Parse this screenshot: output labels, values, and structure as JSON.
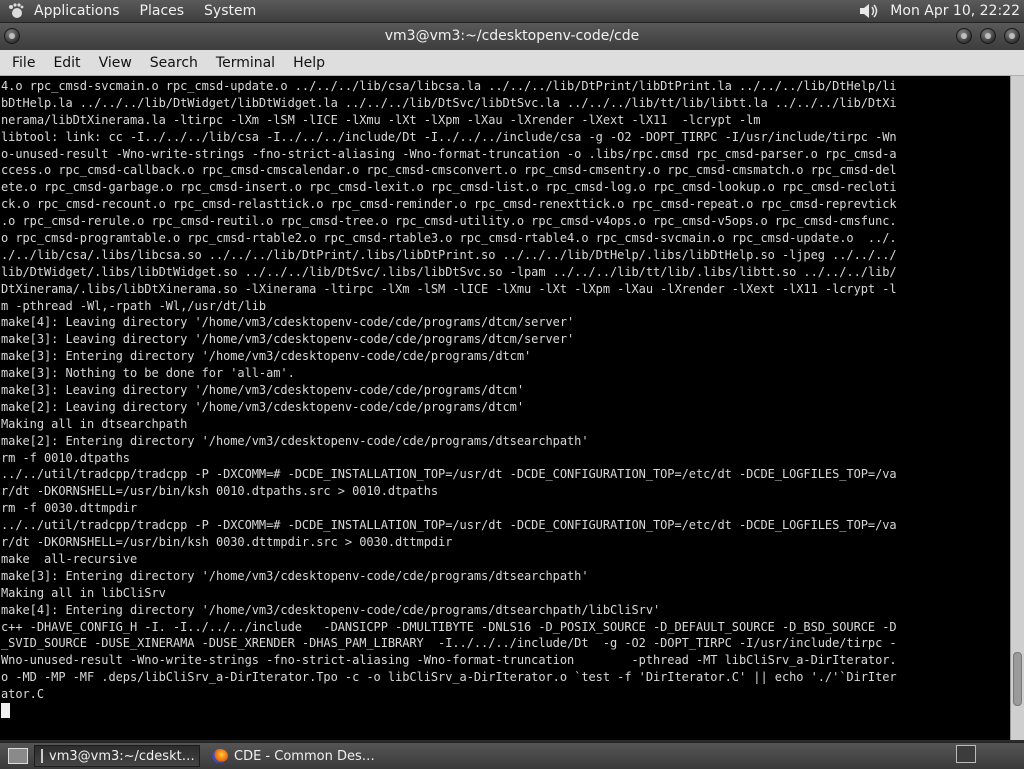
{
  "top_panel": {
    "menus": [
      "Applications",
      "Places",
      "System"
    ],
    "clock": "Mon Apr 10, 22:22",
    "icons": [
      "gnome-foot-icon",
      "volume-icon"
    ]
  },
  "window": {
    "title": "vm3@vm3:~/cdesktopenv-code/cde"
  },
  "menu_bar": {
    "items": [
      "File",
      "Edit",
      "View",
      "Search",
      "Terminal",
      "Help"
    ]
  },
  "terminal": {
    "lines": [
      "4.o rpc_cmsd-svcmain.o rpc_cmsd-update.o ../../../lib/csa/libcsa.la ../../../lib/DtPrint/libDtPrint.la ../../../lib/DtHelp/li",
      "bDtHelp.la ../../../lib/DtWidget/libDtWidget.la ../../../lib/DtSvc/libDtSvc.la ../../../lib/tt/lib/libtt.la ../../../lib/DtXi",
      "nerama/libDtXinerama.la -ltirpc -lXm -lSM -lICE -lXmu -lXt -lXpm -lXau -lXrender -lXext -lX11  -lcrypt -lm",
      "libtool: link: cc -I../../../lib/csa -I../../../include/Dt -I../../../include/csa -g -O2 -DOPT_TIRPC -I/usr/include/tirpc -Wn",
      "o-unused-result -Wno-write-strings -fno-strict-aliasing -Wno-format-truncation -o .libs/rpc.cmsd rpc_cmsd-parser.o rpc_cmsd-a",
      "ccess.o rpc_cmsd-callback.o rpc_cmsd-cmscalendar.o rpc_cmsd-cmsconvert.o rpc_cmsd-cmsentry.o rpc_cmsd-cmsmatch.o rpc_cmsd-del",
      "ete.o rpc_cmsd-garbage.o rpc_cmsd-insert.o rpc_cmsd-lexit.o rpc_cmsd-list.o rpc_cmsd-log.o rpc_cmsd-lookup.o rpc_cmsd-reclоti",
      "ck.o rpc_cmsd-recount.o rpc_cmsd-relasttick.o rpc_cmsd-reminder.o rpc_cmsd-renexttick.o rpc_cmsd-repeat.o rpc_cmsd-reprevtick",
      ".o rpc_cmsd-rerule.o rpc_cmsd-reutil.o rpc_cmsd-tree.o rpc_cmsd-utility.o rpc_cmsd-v4ops.o rpc_cmsd-v5ops.o rpc_cmsd-cmsfunc.",
      "o rpc_cmsd-programtable.o rpc_cmsd-rtable2.o rpc_cmsd-rtable3.o rpc_cmsd-rtable4.o rpc_cmsd-svcmain.o rpc_cmsd-update.o  ../.",
      "./../lib/csa/.libs/libcsa.so ../../../lib/DtPrint/.libs/libDtPrint.so ../../../lib/DtHelp/.libs/libDtHelp.so -ljpeg ../../../",
      "lib/DtWidget/.libs/libDtWidget.so ../../../lib/DtSvc/.libs/libDtSvc.so -lpam ../../../lib/tt/lib/.libs/libtt.so ../../../lib/",
      "DtXinerama/.libs/libDtXinerama.so -lXinerama -ltirpc -lXm -lSM -lICE -lXmu -lXt -lXpm -lXau -lXrender -lXext -lX11 -lcrypt -l",
      "m -pthread -Wl,-rpath -Wl,/usr/dt/lib",
      "make[4]: Leaving directory '/home/vm3/cdesktopenv-code/cde/programs/dtcm/server'",
      "make[3]: Leaving directory '/home/vm3/cdesktopenv-code/cde/programs/dtcm/server'",
      "make[3]: Entering directory '/home/vm3/cdesktopenv-code/cde/programs/dtcm'",
      "make[3]: Nothing to be done for 'all-am'.",
      "make[3]: Leaving directory '/home/vm3/cdesktopenv-code/cde/programs/dtcm'",
      "make[2]: Leaving directory '/home/vm3/cdesktopenv-code/cde/programs/dtcm'",
      "Making all in dtsearchpath",
      "make[2]: Entering directory '/home/vm3/cdesktopenv-code/cde/programs/dtsearchpath'",
      "rm -f 0010.dtpaths",
      "../../util/tradcpp/tradcpp -P -DXCOMM=# -DCDE_INSTALLATION_TOP=/usr/dt -DCDE_CONFIGURATION_TOP=/etc/dt -DCDE_LOGFILES_TOP=/va",
      "r/dt -DKORNSHELL=/usr/bin/ksh 0010.dtpaths.src > 0010.dtpaths",
      "rm -f 0030.dttmpdir",
      "../../util/tradcpp/tradcpp -P -DXCOMM=# -DCDE_INSTALLATION_TOP=/usr/dt -DCDE_CONFIGURATION_TOP=/etc/dt -DCDE_LOGFILES_TOP=/va",
      "r/dt -DKORNSHELL=/usr/bin/ksh 0030.dttmpdir.src > 0030.dttmpdir",
      "make  all-recursive",
      "make[3]: Entering directory '/home/vm3/cdesktopenv-code/cde/programs/dtsearchpath'",
      "Making all in libCliSrv",
      "make[4]: Entering directory '/home/vm3/cdesktopenv-code/cde/programs/dtsearchpath/libCliSrv'",
      "c++ -DHAVE_CONFIG_H -I. -I../../../include   -DANSICPP -DMULTIBYTE -DNLS16 -D_POSIX_SOURCE -D_DEFAULT_SOURCE -D_BSD_SOURCE -D",
      "_SVID_SOURCE -DUSE_XINERAMA -DUSE_XRENDER -DHAS_PAM_LIBRARY  -I../../../include/Dt  -g -O2 -DOPT_TIRPC -I/usr/include/tirpc -",
      "Wno-unused-result -Wno-write-strings -fno-strict-aliasing -Wno-format-truncation        -pthread -MT libCliSrv_a-DirIterator.",
      "o -MD -MP -MF .deps/libCliSrv_a-DirIterator.Tpo -c -o libCliSrv_a-DirIterator.o `test -f 'DirIterator.C' || echo './'`DirIter",
      "ator.C"
    ]
  },
  "scrollbar": {
    "position_fraction": 0.95
  },
  "taskbar": {
    "tasks": [
      {
        "label": "vm3@vm3:~/cdeskt…",
        "icon": "terminal-icon",
        "active": true
      },
      {
        "label": "CDE - Common Des…",
        "icon": "firefox-icon",
        "active": false
      }
    ]
  }
}
